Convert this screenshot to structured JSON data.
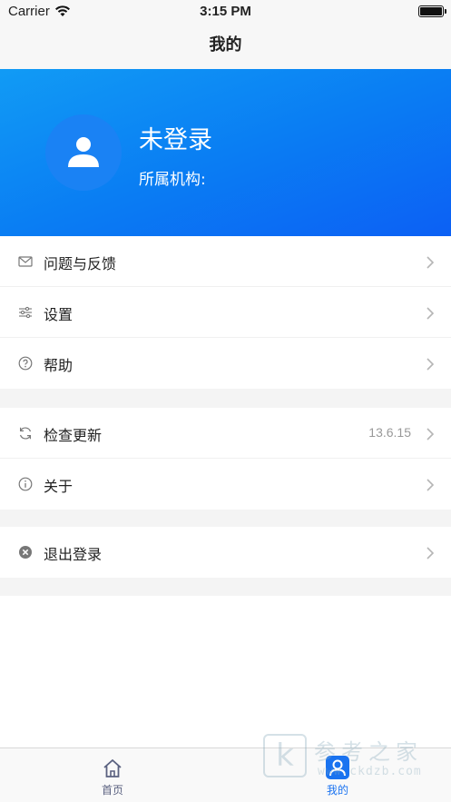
{
  "status_bar": {
    "carrier": "Carrier",
    "time": "3:15 PM"
  },
  "nav": {
    "title": "我的"
  },
  "profile": {
    "name": "未登录",
    "org_label": "所属机构:"
  },
  "menu": {
    "group1": [
      {
        "label": "问题与反馈",
        "icon": "mail-icon"
      },
      {
        "label": "设置",
        "icon": "sliders-icon"
      },
      {
        "label": "帮助",
        "icon": "help-circle-icon"
      }
    ],
    "group2": [
      {
        "label": "检查更新",
        "icon": "refresh-icon",
        "value": "13.6.15"
      },
      {
        "label": "关于",
        "icon": "info-circle-icon"
      }
    ],
    "group3": [
      {
        "label": "退出登录",
        "icon": "close-circle-icon"
      }
    ]
  },
  "tabs": [
    {
      "label": "首页",
      "icon": "home-icon",
      "active": false
    },
    {
      "label": "我的",
      "icon": "user-icon",
      "active": true
    }
  ],
  "watermark": {
    "logo_letter": "k",
    "title": "参考之家",
    "url": "www.ckdzb.com"
  },
  "colors": {
    "header_gradient_start": "#119bf5",
    "header_gradient_end": "#0c60f4",
    "active_tab": "#1a73f0",
    "inactive_tab": "#5a6180"
  }
}
